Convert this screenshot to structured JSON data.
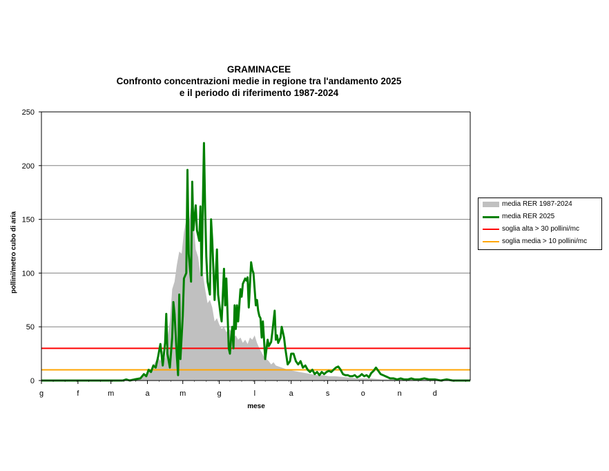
{
  "chart_data": {
    "type": "area",
    "title": [
      "GRAMINACEE",
      "Confronto concentrazioni medie in regione tra l'andamento 2025",
      "e il periodo di riferimento 1987-2024"
    ],
    "xlabel": "mese",
    "ylabel": "pollini/metro cubo di aria",
    "x_ticks": [
      "g",
      "f",
      "m",
      "a",
      "m",
      "g",
      "l",
      "a",
      "s",
      "o",
      "n",
      "d"
    ],
    "y_ticks": [
      0,
      50,
      100,
      150,
      200,
      250
    ],
    "ylim": [
      0,
      250
    ],
    "xlim_days": [
      1,
      365
    ],
    "grid": "horizontal",
    "legend_position": "right",
    "series": [
      {
        "name": "media RER 1987-2024",
        "kind": "area",
        "color": "#c0c0c0",
        "points": [
          [
            1,
            0
          ],
          [
            60,
            0
          ],
          [
            75,
            1
          ],
          [
            85,
            3
          ],
          [
            90,
            6
          ],
          [
            95,
            12
          ],
          [
            98,
            18
          ],
          [
            100,
            22
          ],
          [
            102,
            18
          ],
          [
            104,
            28
          ],
          [
            106,
            20
          ],
          [
            108,
            40
          ],
          [
            110,
            55
          ],
          [
            112,
            85
          ],
          [
            114,
            92
          ],
          [
            116,
            108
          ],
          [
            118,
            120
          ],
          [
            120,
            118
          ],
          [
            122,
            138
          ],
          [
            124,
            150
          ],
          [
            126,
            145
          ],
          [
            128,
            162
          ],
          [
            130,
            148
          ],
          [
            132,
            122
          ],
          [
            134,
            115
          ],
          [
            136,
            98
          ],
          [
            138,
            100
          ],
          [
            140,
            85
          ],
          [
            142,
            72
          ],
          [
            144,
            75
          ],
          [
            146,
            68
          ],
          [
            148,
            55
          ],
          [
            150,
            58
          ],
          [
            152,
            52
          ],
          [
            154,
            48
          ],
          [
            156,
            50
          ],
          [
            158,
            45
          ],
          [
            160,
            48
          ],
          [
            162,
            46
          ],
          [
            164,
            40
          ],
          [
            166,
            42
          ],
          [
            168,
            38
          ],
          [
            170,
            40
          ],
          [
            172,
            35
          ],
          [
            174,
            38
          ],
          [
            176,
            34
          ],
          [
            178,
            40
          ],
          [
            180,
            38
          ],
          [
            182,
            42
          ],
          [
            184,
            35
          ],
          [
            186,
            30
          ],
          [
            188,
            26
          ],
          [
            190,
            22
          ],
          [
            192,
            20
          ],
          [
            194,
            18
          ],
          [
            196,
            15
          ],
          [
            198,
            17
          ],
          [
            200,
            14
          ],
          [
            205,
            12
          ],
          [
            210,
            10
          ],
          [
            215,
            9
          ],
          [
            220,
            8
          ],
          [
            225,
            7
          ],
          [
            230,
            6
          ],
          [
            235,
            5
          ],
          [
            240,
            5
          ],
          [
            245,
            4
          ],
          [
            250,
            4
          ],
          [
            260,
            3
          ],
          [
            270,
            2
          ],
          [
            280,
            2
          ],
          [
            290,
            1
          ],
          [
            300,
            1
          ],
          [
            320,
            1
          ],
          [
            340,
            0
          ],
          [
            365,
            0
          ]
        ]
      },
      {
        "name": "media RER 2025",
        "kind": "line",
        "color": "#008000",
        "points": [
          [
            1,
            0
          ],
          [
            30,
            0
          ],
          [
            60,
            0
          ],
          [
            70,
            0
          ],
          [
            73,
            1
          ],
          [
            76,
            0
          ],
          [
            80,
            1
          ],
          [
            85,
            2
          ],
          [
            88,
            6
          ],
          [
            90,
            4
          ],
          [
            92,
            10
          ],
          [
            94,
            8
          ],
          [
            96,
            14
          ],
          [
            98,
            12
          ],
          [
            100,
            22
          ],
          [
            102,
            34
          ],
          [
            104,
            14
          ],
          [
            106,
            35
          ],
          [
            107,
            62
          ],
          [
            108,
            25
          ],
          [
            110,
            12
          ],
          [
            112,
            40
          ],
          [
            113,
            73
          ],
          [
            114,
            62
          ],
          [
            116,
            22
          ],
          [
            117,
            5
          ],
          [
            118,
            80
          ],
          [
            119,
            20
          ],
          [
            121,
            60
          ],
          [
            122,
            95
          ],
          [
            124,
            100
          ],
          [
            125,
            196
          ],
          [
            126,
            118
          ],
          [
            128,
            92
          ],
          [
            129,
            185
          ],
          [
            130,
            140
          ],
          [
            132,
            163
          ],
          [
            133,
            140
          ],
          [
            135,
            130
          ],
          [
            136,
            162
          ],
          [
            137,
            98
          ],
          [
            139,
            221
          ],
          [
            140,
            160
          ],
          [
            141,
            115
          ],
          [
            142,
            92
          ],
          [
            144,
            80
          ],
          [
            145,
            150
          ],
          [
            146,
            130
          ],
          [
            148,
            75
          ],
          [
            149,
            98
          ],
          [
            150,
            122
          ],
          [
            151,
            80
          ],
          [
            153,
            62
          ],
          [
            154,
            55
          ],
          [
            156,
            104
          ],
          [
            157,
            70
          ],
          [
            158,
            95
          ],
          [
            160,
            30
          ],
          [
            161,
            25
          ],
          [
            162,
            40
          ],
          [
            163,
            50
          ],
          [
            164,
            30
          ],
          [
            165,
            70
          ],
          [
            166,
            48
          ],
          [
            167,
            70
          ],
          [
            168,
            55
          ],
          [
            170,
            85
          ],
          [
            171,
            78
          ],
          [
            172,
            90
          ],
          [
            174,
            95
          ],
          [
            175,
            93
          ],
          [
            176,
            96
          ],
          [
            177,
            68
          ],
          [
            179,
            110
          ],
          [
            180,
            103
          ],
          [
            181,
            100
          ],
          [
            182,
            85
          ],
          [
            183,
            70
          ],
          [
            184,
            75
          ],
          [
            185,
            65
          ],
          [
            186,
            60
          ],
          [
            187,
            58
          ],
          [
            188,
            40
          ],
          [
            189,
            55
          ],
          [
            190,
            38
          ],
          [
            191,
            20
          ],
          [
            193,
            38
          ],
          [
            194,
            32
          ],
          [
            196,
            36
          ],
          [
            197,
            45
          ],
          [
            199,
            65
          ],
          [
            200,
            38
          ],
          [
            201,
            42
          ],
          [
            202,
            35
          ],
          [
            204,
            40
          ],
          [
            205,
            50
          ],
          [
            206,
            45
          ],
          [
            207,
            40
          ],
          [
            208,
            30
          ],
          [
            210,
            15
          ],
          [
            212,
            18
          ],
          [
            213,
            25
          ],
          [
            215,
            25
          ],
          [
            217,
            18
          ],
          [
            219,
            15
          ],
          [
            221,
            18
          ],
          [
            223,
            12
          ],
          [
            225,
            14
          ],
          [
            227,
            10
          ],
          [
            229,
            8
          ],
          [
            231,
            10
          ],
          [
            233,
            6
          ],
          [
            235,
            8
          ],
          [
            237,
            5
          ],
          [
            239,
            8
          ],
          [
            241,
            6
          ],
          [
            243,
            8
          ],
          [
            245,
            9
          ],
          [
            247,
            8
          ],
          [
            249,
            10
          ],
          [
            251,
            12
          ],
          [
            253,
            13
          ],
          [
            255,
            10
          ],
          [
            257,
            6
          ],
          [
            259,
            5
          ],
          [
            261,
            5
          ],
          [
            263,
            4
          ],
          [
            265,
            4
          ],
          [
            267,
            5
          ],
          [
            269,
            3
          ],
          [
            271,
            4
          ],
          [
            273,
            6
          ],
          [
            275,
            4
          ],
          [
            277,
            5
          ],
          [
            279,
            3
          ],
          [
            281,
            7
          ],
          [
            283,
            9
          ],
          [
            285,
            12
          ],
          [
            287,
            9
          ],
          [
            289,
            6
          ],
          [
            291,
            5
          ],
          [
            293,
            4
          ],
          [
            295,
            3
          ],
          [
            297,
            2
          ],
          [
            300,
            2
          ],
          [
            303,
            1
          ],
          [
            306,
            2
          ],
          [
            309,
            1
          ],
          [
            312,
            1
          ],
          [
            315,
            2
          ],
          [
            318,
            1
          ],
          [
            322,
            1
          ],
          [
            326,
            2
          ],
          [
            330,
            1
          ],
          [
            335,
            1
          ],
          [
            340,
            0
          ],
          [
            345,
            1
          ],
          [
            350,
            0
          ],
          [
            365,
            0
          ]
        ]
      },
      {
        "name": "soglia alta > 30 pollini/mc",
        "kind": "threshold",
        "color": "#ff0000",
        "value": 30
      },
      {
        "name": "soglia media > 10 pollini/mc",
        "kind": "threshold",
        "color": "#ffa500",
        "value": 10
      }
    ]
  }
}
